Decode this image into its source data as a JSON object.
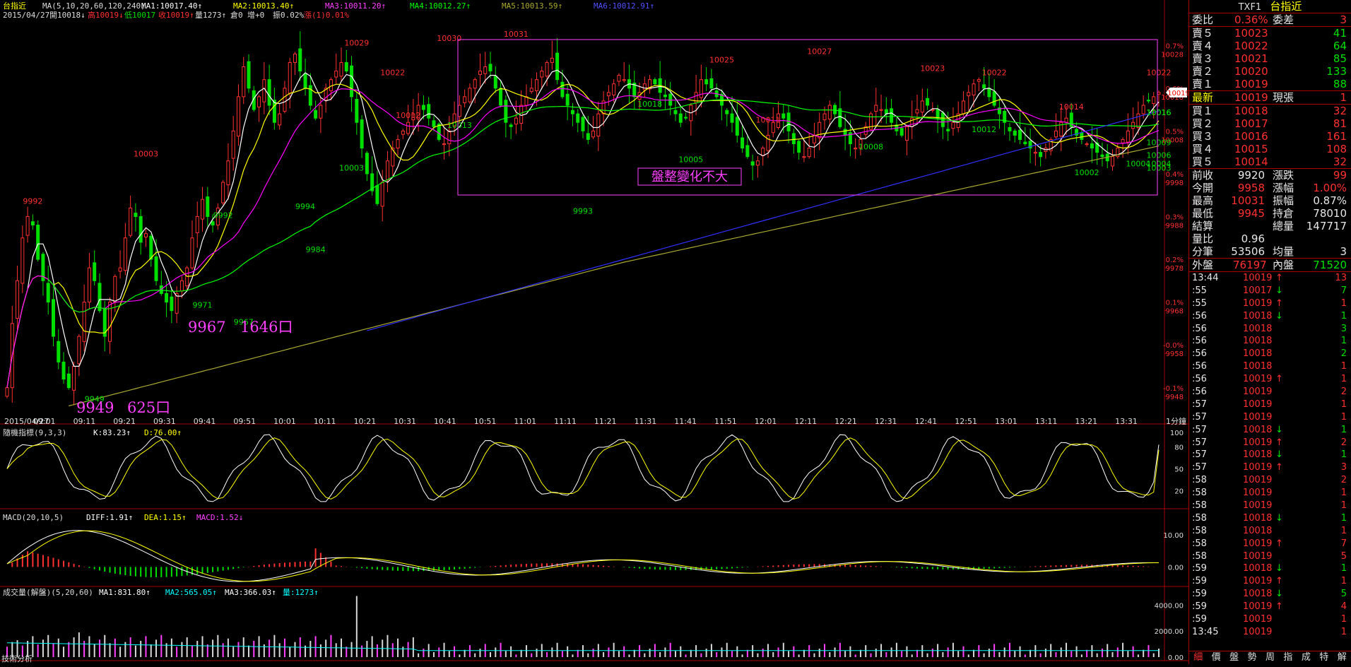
{
  "header": {
    "symbol": "台指近",
    "ma_text": "MA(5,10,20,60,120,240)",
    "ma1": "MA1:10017.40↑",
    "ma2": "MA2:10013.40↑",
    "ma3": "MA3:10011.20↑",
    "ma4": "MA4:10012.27↑",
    "ma5": "MA5:10013.59↑",
    "ma6": "MA6:10012.91↑",
    "line2_date": "2015/04/27",
    "line2_open": "開10018↓",
    "line2_high": "高10019↓",
    "line2_low": "低10017",
    "line2_close": "收10019↑",
    "line2_vol": "量1273↑",
    "line2_oi": "倉0",
    "line2_inc": "增+0",
    "line2_amp": "振0.02%",
    "line2_chg": "漲(1)0.01%"
  },
  "main_chart_annotations": {
    "box_label": "盤整變化不大",
    "note1_price": "9967",
    "note1_pts": "1646口",
    "note2_price": "9949",
    "note2_pts": "625口",
    "cur_price_tag": "10019"
  },
  "chart_data": [
    {
      "type": "candlestick",
      "title": "台指近 1分鐘",
      "x": [
        "2015/04/27",
        "09:01",
        "09:11",
        "09:21",
        "09:31",
        "09:41",
        "09:51",
        "10:01",
        "10:11",
        "10:21",
        "10:31",
        "10:41",
        "10:51",
        "11:01",
        "11:11",
        "11:21",
        "11:31",
        "11:41",
        "11:51",
        "12:01",
        "12:11",
        "12:21",
        "12:31",
        "12:41",
        "12:51",
        "13:01",
        "13:11",
        "13:21",
        "13:31"
      ],
      "period_label": "1分鐘",
      "y_ticks": [
        9948,
        9958,
        9968,
        9978,
        9988,
        9998,
        10008,
        10018,
        10028
      ],
      "y_pct_ticks": [
        "-0.1%",
        "-0.0%",
        "0.1%",
        "0.2%",
        "0.3%",
        "0.4%",
        "0.5%",
        "0.6%",
        "0.7%"
      ],
      "ylim": [
        9944,
        10034
      ],
      "price_labels": [
        {
          "t": 5,
          "v": 9992
        },
        {
          "t": 17,
          "v": 9949
        },
        {
          "t": 27,
          "v": 10003
        },
        {
          "t": 38,
          "v": 9971
        },
        {
          "t": 42,
          "v": 9992
        },
        {
          "t": 46,
          "v": 9967
        },
        {
          "t": 58,
          "v": 9994
        },
        {
          "t": 60,
          "v": 9984
        },
        {
          "t": 67,
          "v": 10003
        },
        {
          "t": 68,
          "v": 10029
        },
        {
          "t": 75,
          "v": 10022
        },
        {
          "t": 78,
          "v": 10012
        },
        {
          "t": 86,
          "v": 10030
        },
        {
          "t": 88,
          "v": 10013
        },
        {
          "t": 99,
          "v": 10031
        },
        {
          "t": 112,
          "v": 9993
        },
        {
          "t": 125,
          "v": 10018
        },
        {
          "t": 133,
          "v": 10005
        },
        {
          "t": 139,
          "v": 10025
        },
        {
          "t": 148,
          "v": 10011
        },
        {
          "t": 158,
          "v": 10027
        },
        {
          "t": 168,
          "v": 10008
        },
        {
          "t": 180,
          "v": 10023
        },
        {
          "t": 190,
          "v": 10012
        },
        {
          "t": 192,
          "v": 10022
        },
        {
          "t": 207,
          "v": 10014
        },
        {
          "t": 210,
          "v": 10002
        },
        {
          "t": 220,
          "v": 10004
        },
        {
          "t": 228,
          "v": 10016
        },
        {
          "t": 231,
          "v": 10006
        },
        {
          "t": 237,
          "v": 10016
        },
        {
          "t": 245,
          "v": 10009
        },
        {
          "t": 248,
          "v": 10022
        },
        {
          "t": 258,
          "v": 10004
        },
        {
          "t": 266,
          "v": 10016
        },
        {
          "t": 270,
          "v": 10003
        }
      ],
      "close_path": [
        9950,
        9965,
        9975,
        9985,
        9990,
        9988,
        9980,
        9975,
        9970,
        9962,
        9956,
        9952,
        9950,
        9955,
        9962,
        9970,
        9978,
        9975,
        9968,
        9962,
        9970,
        9976,
        9978,
        9985,
        9992,
        9990,
        9984,
        9986,
        9980,
        9975,
        9972,
        9970,
        9968,
        9972,
        9975,
        9978,
        9985,
        9990,
        9994,
        9990,
        9988,
        9992,
        9998,
        10003,
        10010,
        10018,
        10025,
        10020,
        10015,
        10018,
        10022,
        10016,
        10012,
        10014,
        10020,
        10026,
        10028,
        10024,
        10020,
        10016,
        10013,
        10016,
        10020,
        10022,
        10024,
        10026,
        10024,
        10018,
        10012,
        10006,
        10000,
        9996,
        9993,
        9998,
        10003,
        10006,
        10008,
        10010,
        10012,
        10014,
        10016,
        10015,
        10013,
        10011,
        10008,
        10007,
        10010,
        10014,
        10016,
        10018,
        10020,
        10022,
        10024,
        10025,
        10024,
        10020,
        10016,
        10012,
        10011,
        10013,
        10016,
        10018,
        10020,
        10022,
        10024,
        10026,
        10027,
        10022,
        10018,
        10016,
        10014,
        10012,
        10010,
        10008,
        10010,
        10014,
        10017,
        10019,
        10021,
        10023,
        10022,
        10020,
        10018,
        10019,
        10021,
        10022,
        10021,
        10019,
        10018,
        10016,
        10014,
        10012,
        10013,
        10016,
        10019,
        10022,
        10021,
        10020,
        10018,
        10016,
        10014,
        10012,
        10009,
        10006,
        10004,
        10002,
        10003,
        10006,
        10009,
        10012,
        10014,
        10013,
        10010,
        10007,
        10005,
        10004,
        10006,
        10009,
        10012,
        10014,
        10016,
        10014,
        10011,
        10009,
        10007,
        10006,
        10008,
        10011,
        10014,
        10016,
        10015,
        10014,
        10012,
        10010,
        10009,
        10011,
        10013,
        10015,
        10017,
        10016,
        10015,
        10013,
        10011,
        10010,
        10012,
        10014,
        10017,
        10019,
        10021,
        10022,
        10020,
        10018,
        10016,
        10014,
        10012,
        10010,
        10009,
        10008,
        10007,
        10006,
        10005,
        10004,
        10006,
        10008,
        10010,
        10012,
        10013,
        10011,
        10009,
        10008,
        10007,
        10006,
        10005,
        10004,
        10003,
        10004,
        10006,
        10008,
        10010,
        10012,
        10014,
        10016,
        10017,
        10018,
        10019
      ]
    },
    {
      "type": "line",
      "title": "隨機指標(9,3,3)",
      "k_label": "K:83.23↑",
      "d_label": "D:76.00↑",
      "y_ticks": [
        20,
        50,
        80,
        100
      ],
      "ylim": [
        0,
        100
      ]
    },
    {
      "type": "line",
      "title": "MACD(20,10,5)",
      "diff_label": "DIFF:1.91↑",
      "dea_label": "DEA:1.15↑",
      "macd_label": "MACD:1.52↓",
      "y_ticks": [
        "0.00",
        "10.00"
      ],
      "ylim": [
        -5,
        16
      ]
    },
    {
      "type": "bar",
      "title": "成交量(解盤)(5,20,60)",
      "ma1_label": "MA1:831.80↑",
      "ma2_label": "MA2:565.05↑",
      "ma3_label": "MA3:366.03↑",
      "vol_label": "量:1273↑",
      "y_ticks": [
        "0.00",
        "2000.00",
        "4000.00"
      ],
      "ylim": [
        0,
        5000
      ]
    }
  ],
  "bottom_label": "技術分析",
  "side": {
    "code": "TXF1",
    "name": "台指近",
    "weibi_label": "委比",
    "weibi_val": "0.36%",
    "weicha_label": "委差",
    "weicha_val": "3",
    "asks": [
      {
        "label": "賣５",
        "price": "10023",
        "vol": "41"
      },
      {
        "label": "賣４",
        "price": "10022",
        "vol": "64"
      },
      {
        "label": "賣３",
        "price": "10021",
        "vol": "85"
      },
      {
        "label": "賣２",
        "price": "10020",
        "vol": "133"
      },
      {
        "label": "賣１",
        "price": "10019",
        "vol": "88"
      }
    ],
    "last_label": "最新",
    "last_price": "10019",
    "xianzhang_label": "現張",
    "xianzhang_val": "1",
    "bids": [
      {
        "label": "買１",
        "price": "10018",
        "vol": "32"
      },
      {
        "label": "買２",
        "price": "10017",
        "vol": "81"
      },
      {
        "label": "買３",
        "price": "10016",
        "vol": "161"
      },
      {
        "label": "買４",
        "price": "10015",
        "vol": "108"
      },
      {
        "label": "買５",
        "price": "10014",
        "vol": "32"
      }
    ],
    "stats": [
      {
        "l1": "前收",
        "v1": "9920",
        "c1": "wht",
        "l2": "漲跌",
        "v2": "99",
        "c2": "red"
      },
      {
        "l1": "今開",
        "v1": "9958",
        "c1": "red",
        "l2": "漲幅",
        "v2": "1.00%",
        "c2": "red"
      },
      {
        "l1": "最高",
        "v1": "10031",
        "c1": "red",
        "l2": "振幅",
        "v2": "0.87%",
        "c2": "wht"
      },
      {
        "l1": "最低",
        "v1": "9945",
        "c1": "red",
        "l2": "持倉",
        "v2": "78010",
        "c2": "wht"
      },
      {
        "l1": "結算",
        "v1": "",
        "c1": "wht",
        "l2": "總量",
        "v2": "147717",
        "c2": "wht"
      },
      {
        "l1": "量比",
        "v1": "0.96",
        "c1": "wht",
        "l2": "",
        "v2": "",
        "c2": "wht"
      },
      {
        "l1": "分筆",
        "v1": "53506",
        "c1": "wht",
        "l2": "均量",
        "v2": "3",
        "c2": "wht"
      }
    ],
    "outer_label": "外盤",
    "outer_val": "76197",
    "inner_label": "內盤",
    "inner_val": "71520",
    "ticks": [
      {
        "t": "13:44",
        "p": "10019",
        "a": "↑",
        "ac": "red",
        "v": "13",
        "vc": "red"
      },
      {
        "t": ":55",
        "p": "10017",
        "a": "↓",
        "ac": "grn",
        "v": "7",
        "vc": "grn"
      },
      {
        "t": ":55",
        "p": "10019",
        "a": "↑",
        "ac": "red",
        "v": "1",
        "vc": "red"
      },
      {
        "t": ":56",
        "p": "10018",
        "a": "↓",
        "ac": "grn",
        "v": "1",
        "vc": "grn"
      },
      {
        "t": ":56",
        "p": "10018",
        "a": "",
        "ac": "red",
        "v": "3",
        "vc": "grn"
      },
      {
        "t": ":56",
        "p": "10018",
        "a": "",
        "ac": "red",
        "v": "1",
        "vc": "grn"
      },
      {
        "t": ":56",
        "p": "10018",
        "a": "",
        "ac": "red",
        "v": "2",
        "vc": "grn"
      },
      {
        "t": ":56",
        "p": "10018",
        "a": "",
        "ac": "red",
        "v": "1",
        "vc": "red"
      },
      {
        "t": ":56",
        "p": "10019",
        "a": "↑",
        "ac": "red",
        "v": "1",
        "vc": "red"
      },
      {
        "t": ":56",
        "p": "10019",
        "a": "",
        "ac": "red",
        "v": "2",
        "vc": "red"
      },
      {
        "t": ":57",
        "p": "10019",
        "a": "",
        "ac": "red",
        "v": "1",
        "vc": "red"
      },
      {
        "t": ":57",
        "p": "10019",
        "a": "",
        "ac": "red",
        "v": "1",
        "vc": "red"
      },
      {
        "t": ":57",
        "p": "10018",
        "a": "↓",
        "ac": "grn",
        "v": "1",
        "vc": "grn"
      },
      {
        "t": ":57",
        "p": "10019",
        "a": "↑",
        "ac": "red",
        "v": "2",
        "vc": "red"
      },
      {
        "t": ":57",
        "p": "10018",
        "a": "↓",
        "ac": "grn",
        "v": "1",
        "vc": "grn"
      },
      {
        "t": ":57",
        "p": "10019",
        "a": "↑",
        "ac": "red",
        "v": "3",
        "vc": "red"
      },
      {
        "t": ":58",
        "p": "10019",
        "a": "",
        "ac": "red",
        "v": "2",
        "vc": "red"
      },
      {
        "t": ":58",
        "p": "10019",
        "a": "",
        "ac": "red",
        "v": "1",
        "vc": "red"
      },
      {
        "t": ":58",
        "p": "10019",
        "a": "",
        "ac": "red",
        "v": "1",
        "vc": "red"
      },
      {
        "t": ":58",
        "p": "10018",
        "a": "↓",
        "ac": "grn",
        "v": "1",
        "vc": "grn"
      },
      {
        "t": ":58",
        "p": "10018",
        "a": "",
        "ac": "red",
        "v": "1",
        "vc": "red"
      },
      {
        "t": ":58",
        "p": "10019",
        "a": "↑",
        "ac": "red",
        "v": "7",
        "vc": "red"
      },
      {
        "t": ":58",
        "p": "10019",
        "a": "",
        "ac": "red",
        "v": "5",
        "vc": "red"
      },
      {
        "t": ":59",
        "p": "10018",
        "a": "↓",
        "ac": "grn",
        "v": "1",
        "vc": "grn"
      },
      {
        "t": ":59",
        "p": "10019",
        "a": "↑",
        "ac": "red",
        "v": "1",
        "vc": "red"
      },
      {
        "t": ":59",
        "p": "10018",
        "a": "↓",
        "ac": "grn",
        "v": "5",
        "vc": "grn"
      },
      {
        "t": ":59",
        "p": "10019",
        "a": "↑",
        "ac": "red",
        "v": "4",
        "vc": "red"
      },
      {
        "t": ":59",
        "p": "10019",
        "a": "",
        "ac": "red",
        "v": "1",
        "vc": "red"
      },
      {
        "t": "13:45",
        "p": "10019",
        "a": "",
        "ac": "red",
        "v": "1",
        "vc": "red"
      }
    ],
    "tabs": [
      "細",
      "價",
      "盤",
      "勢",
      "周",
      "指",
      "成",
      "特",
      "解"
    ]
  },
  "colors": {
    "up": "#ff3030",
    "down": "#00e000",
    "grid_border": "#aa0000",
    "ma1": "#ffffff",
    "ma2": "#ffff00",
    "ma3": "#ff00ff",
    "ma4": "#00ff00",
    "ma5": "#aaaa30",
    "ma6": "#3030ff"
  }
}
